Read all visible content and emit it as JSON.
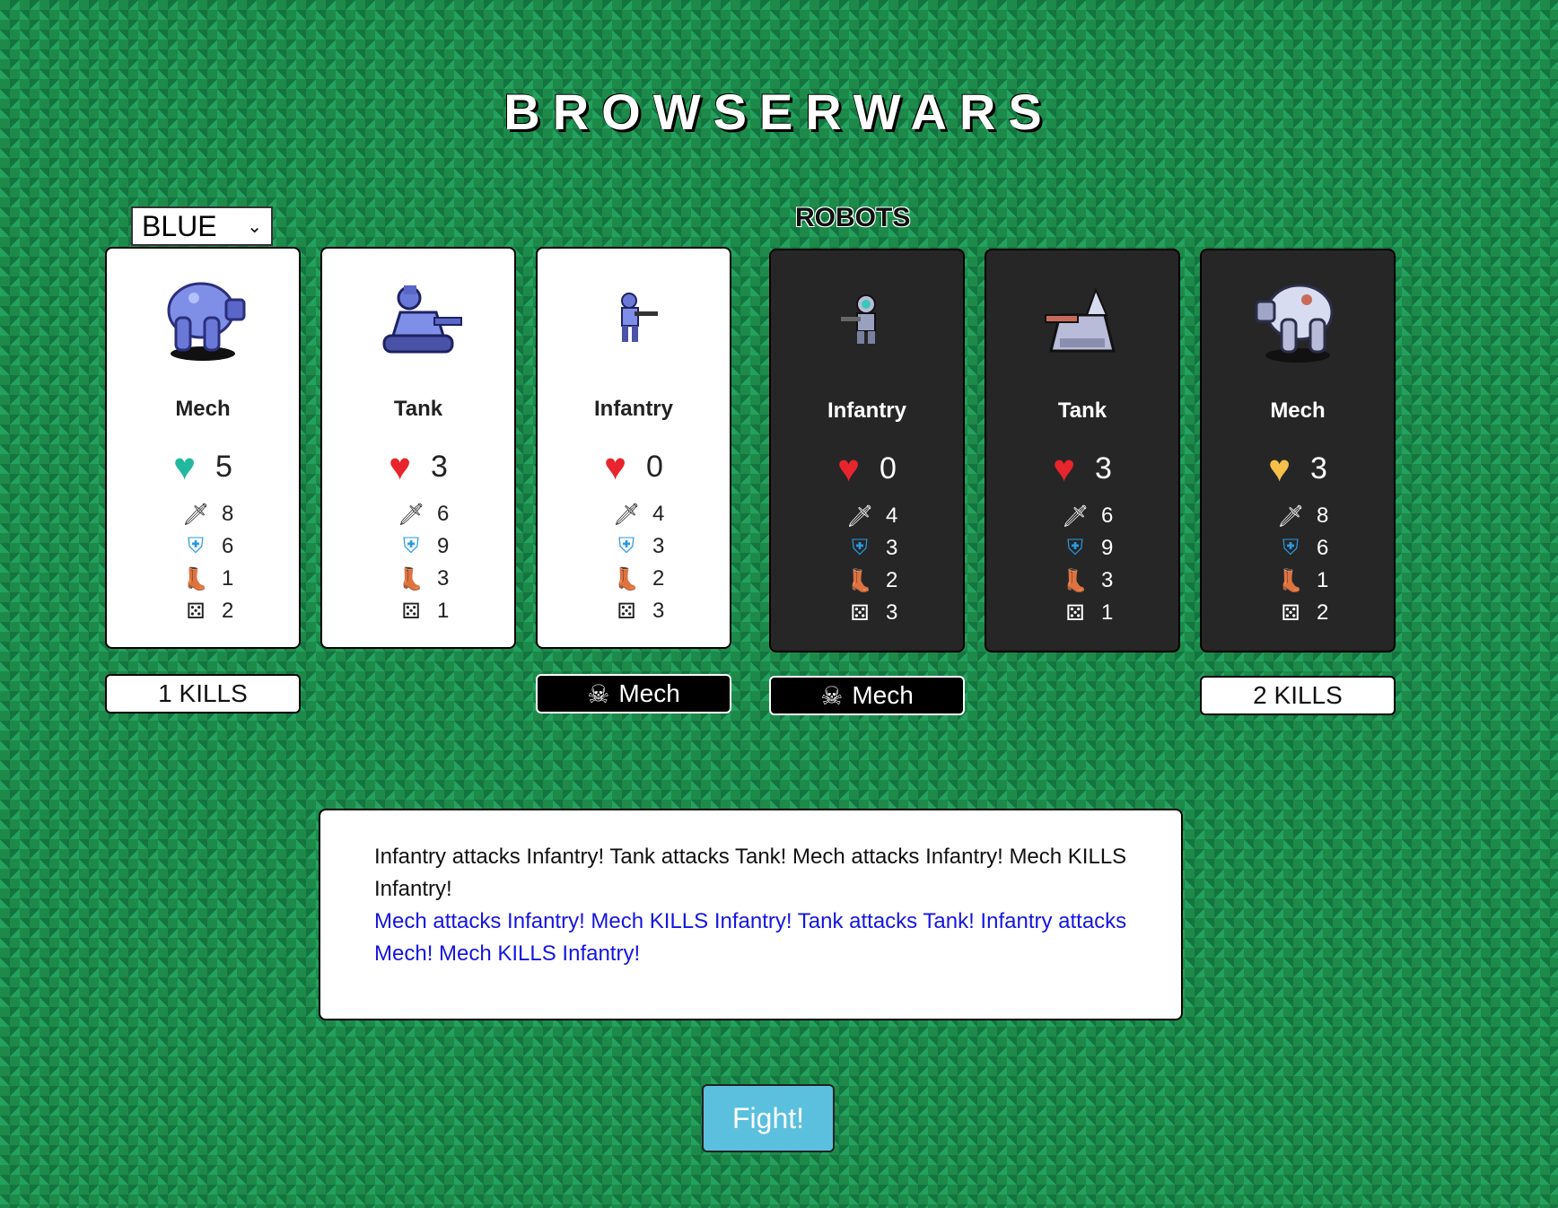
{
  "title": "BROWSERWARS",
  "team_select": {
    "value": "BLUE"
  },
  "opponent_label": "ROBOTS",
  "player_units": [
    {
      "name": "Mech",
      "hp": "5",
      "heart": "teal",
      "attack": "8",
      "defense": "6",
      "move": "1",
      "dice": "2"
    },
    {
      "name": "Tank",
      "hp": "3",
      "heart": "red",
      "attack": "6",
      "defense": "9",
      "move": "3",
      "dice": "1"
    },
    {
      "name": "Infantry",
      "hp": "0",
      "heart": "red",
      "attack": "4",
      "defense": "3",
      "move": "2",
      "dice": "3"
    }
  ],
  "enemy_units": [
    {
      "name": "Infantry",
      "hp": "0",
      "heart": "red",
      "attack": "4",
      "defense": "3",
      "move": "2",
      "dice": "3"
    },
    {
      "name": "Tank",
      "hp": "3",
      "heart": "red",
      "attack": "6",
      "defense": "9",
      "move": "3",
      "dice": "1"
    },
    {
      "name": "Mech",
      "hp": "3",
      "heart": "yellow",
      "attack": "8",
      "defense": "6",
      "move": "1",
      "dice": "2"
    }
  ],
  "badges": {
    "p0": "1 KILLS",
    "p2": "Mech",
    "e0": "Mech",
    "e2": "2 KILLS"
  },
  "log": {
    "line1": "Infantry attacks Infantry! Tank attacks Tank! Mech attacks Infantry! Mech KILLS Infantry!",
    "line2": "Mech attacks Infantry! Mech KILLS Infantry! Tank attacks Tank! Infantry attacks Mech! Mech KILLS Infantry!"
  },
  "fight_label": "Fight!",
  "colors": {
    "heart_teal": "#22b8a0",
    "heart_red": "#e8242c",
    "heart_yellow": "#f5c04a",
    "fight_button": "#5bc0de"
  }
}
